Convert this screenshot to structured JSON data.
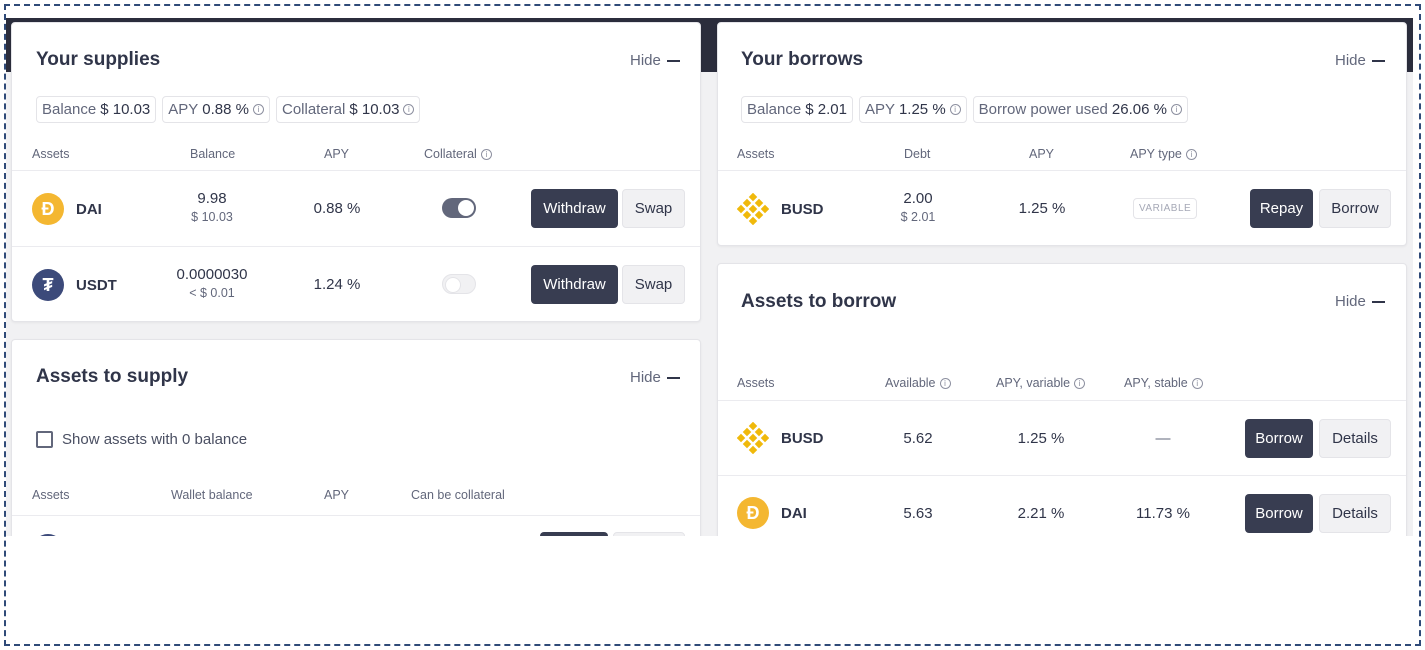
{
  "supplies": {
    "title": "Your supplies",
    "hide": "Hide",
    "chips": [
      {
        "label": "Balance",
        "value": "$ 10.03"
      },
      {
        "label": "APY",
        "value": "0.88 %"
      },
      {
        "label": "Collateral",
        "value": "$ 10.03"
      }
    ],
    "headers": {
      "assets": "Assets",
      "balance": "Balance",
      "apy": "APY",
      "collateral": "Collateral"
    },
    "rows": [
      {
        "symbol": "DAI",
        "balance": "9.98",
        "balance_usd": "$ 10.03",
        "apy": "0.88 %",
        "collateral_on": true,
        "withdraw": "Withdraw",
        "swap": "Swap"
      },
      {
        "symbol": "USDT",
        "balance": "0.0000030",
        "balance_usd": "< $ 0.01",
        "apy": "1.24 %",
        "collateral_on": false,
        "withdraw": "Withdraw",
        "swap": "Swap"
      }
    ]
  },
  "to_supply": {
    "title": "Assets to supply",
    "hide": "Hide",
    "checkbox_label": "Show assets with 0 balance",
    "headers": {
      "assets": "Assets",
      "wallet_balance": "Wallet balance",
      "apy": "APY",
      "can_be_collateral": "Can be collateral"
    }
  },
  "borrows": {
    "title": "Your borrows",
    "hide": "Hide",
    "chips": [
      {
        "label": "Balance",
        "value": "$ 2.01"
      },
      {
        "label": "APY",
        "value": "1.25 %"
      },
      {
        "label": "Borrow power used",
        "value": "26.06 %"
      }
    ],
    "headers": {
      "assets": "Assets",
      "debt": "Debt",
      "apy": "APY",
      "apy_type": "APY type"
    },
    "rows": [
      {
        "symbol": "BUSD",
        "debt": "2.00",
        "debt_usd": "$ 2.01",
        "apy": "1.25 %",
        "apy_type": "VARIABLE",
        "repay": "Repay",
        "borrow": "Borrow"
      }
    ]
  },
  "to_borrow": {
    "title": "Assets to borrow",
    "hide": "Hide",
    "headers": {
      "assets": "Assets",
      "available": "Available",
      "apy_variable": "APY, variable",
      "apy_stable": "APY, stable"
    },
    "rows": [
      {
        "symbol": "BUSD",
        "available": "5.62",
        "apy_variable": "1.25 %",
        "apy_stable": "—",
        "borrow": "Borrow",
        "details": "Details"
      },
      {
        "symbol": "DAI",
        "available": "5.63",
        "apy_variable": "2.21 %",
        "apy_stable": "11.73 %",
        "borrow": "Borrow",
        "details": "Details"
      }
    ]
  },
  "colors": {
    "dark_button": "#383d51",
    "dai": "#f4b731",
    "busd": "#f0b90b",
    "usdt": "#3c4a7a",
    "topbar": "#2b2d3c"
  },
  "icons": {
    "info": "info-icon",
    "dai": "dai-coin-icon",
    "usdt": "usdt-coin-icon",
    "busd": "busd-coin-icon"
  }
}
